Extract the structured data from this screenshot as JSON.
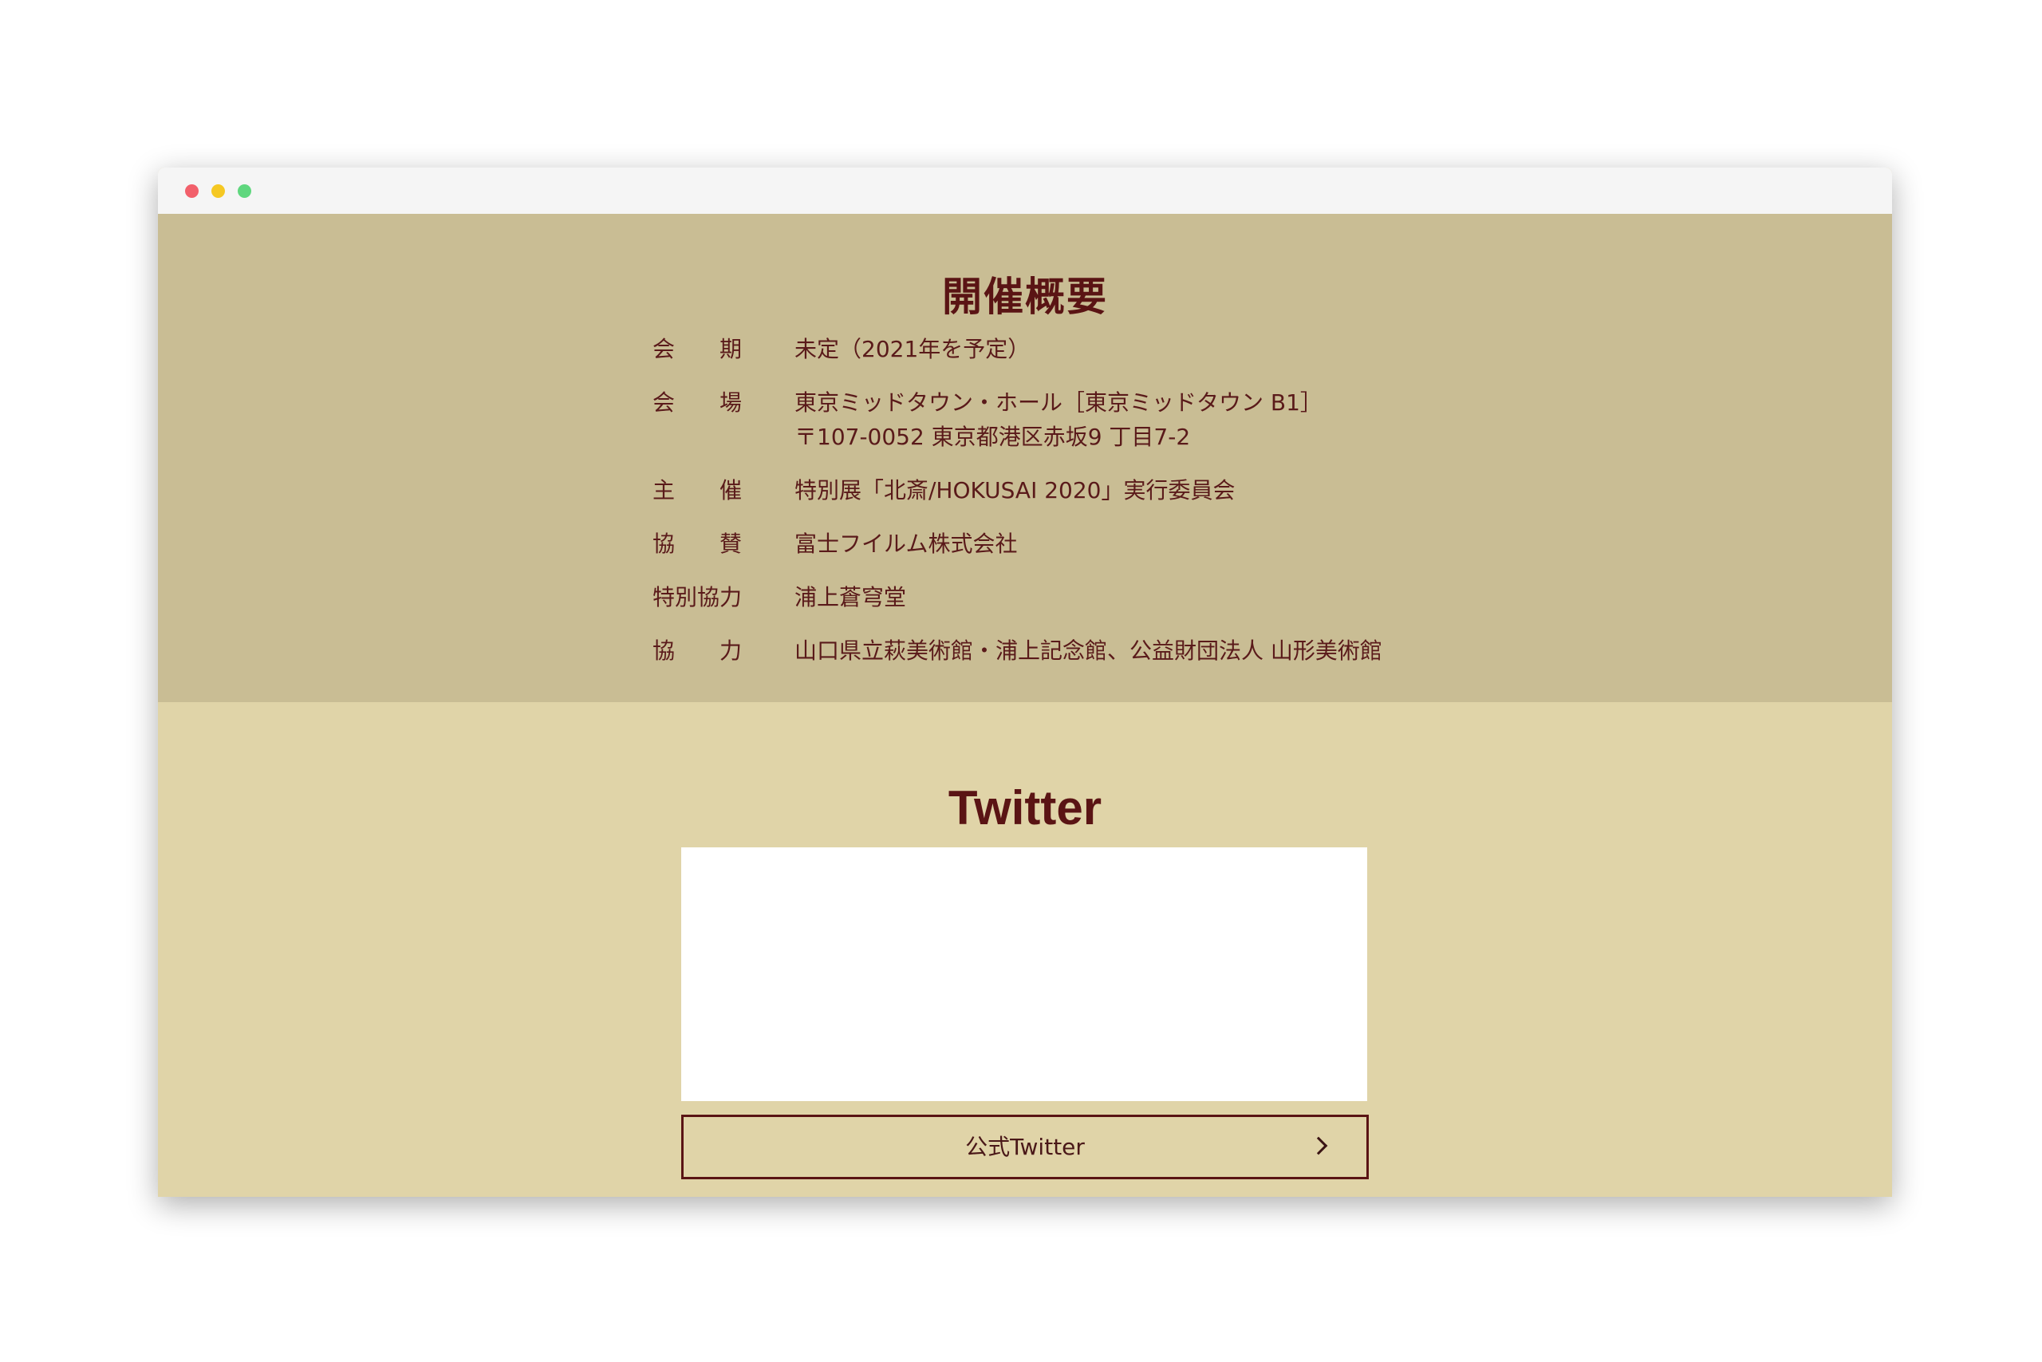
{
  "window": {
    "controls": [
      "close",
      "minimize",
      "maximize"
    ]
  },
  "overview": {
    "title": "開催概要",
    "rows": [
      {
        "label_chars": [
          "会",
          "期"
        ],
        "value": "未定（2021年を予定）",
        "value2": ""
      },
      {
        "label_chars": [
          "会",
          "場"
        ],
        "value": "東京ミッドタウン・ホール［東京ミッドタウン B1］",
        "value2": "〒107-0052 東京都港区赤坂9 丁目7-2"
      },
      {
        "label_chars": [
          "主",
          "催"
        ],
        "value": "特別展「北斎/HOKUSAI 2020」実行委員会",
        "value2": ""
      },
      {
        "label_chars": [
          "協",
          "賛"
        ],
        "value": "富士フイルム株式会社",
        "value2": ""
      },
      {
        "label": "特別協力",
        "value": "浦上蒼穹堂",
        "value2": ""
      },
      {
        "label_chars": [
          "協",
          "力"
        ],
        "value": "山口県立萩美術館・浦上記念館、公益財団法人 山形美術館",
        "value2": ""
      }
    ]
  },
  "twitter": {
    "title": "Twitter",
    "button_label": "公式Twitter",
    "button_icon": "chevron-right-icon"
  },
  "colors": {
    "overview_bg": "#c9bd94",
    "twitter_bg": "#e0d4a8",
    "text_dark_red": "#5a1414"
  }
}
